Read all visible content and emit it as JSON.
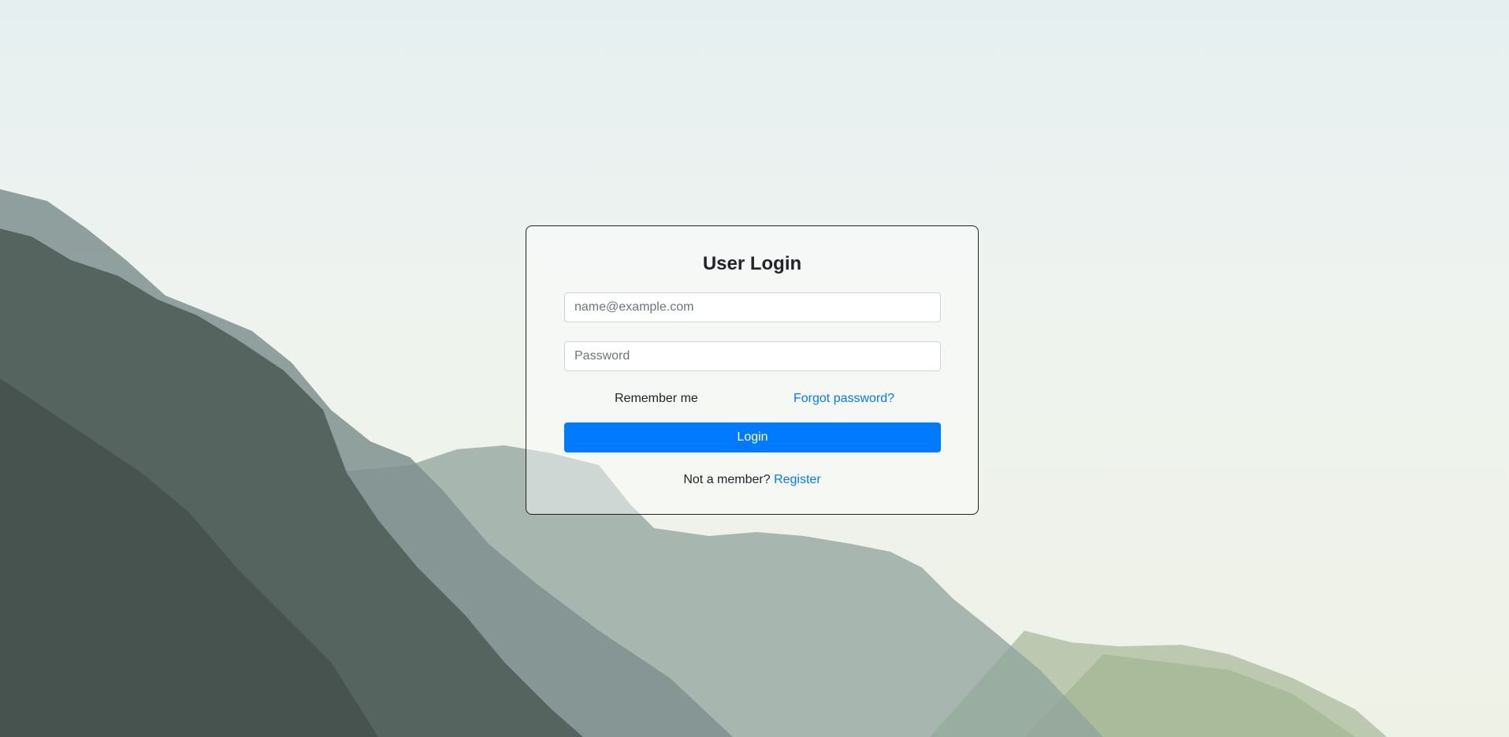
{
  "login_form": {
    "title": "User Login",
    "email_placeholder": "name@example.com",
    "password_placeholder": "Password",
    "remember_label": "Remember me",
    "forgot_label": "Forgot password?",
    "submit_label": "Login",
    "signup_prompt": "Not a member?",
    "register_label": "Register"
  },
  "colors": {
    "primary": "#007bff",
    "text": "#212529"
  }
}
